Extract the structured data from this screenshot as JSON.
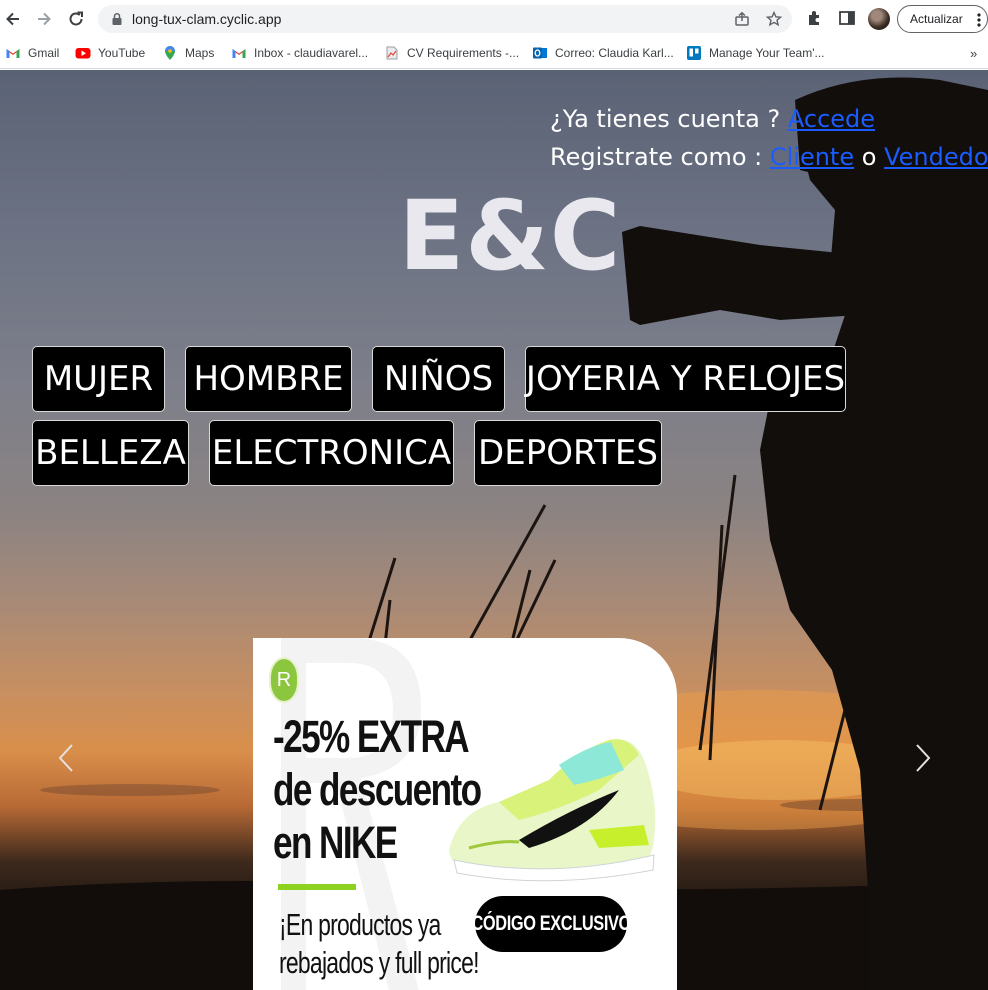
{
  "browser": {
    "url": "long-tux-clam.cyclic.app",
    "update_label": "Actualizar",
    "bookmarks": [
      {
        "label": "Gmail",
        "icon": "gmail-icon"
      },
      {
        "label": "YouTube",
        "icon": "youtube-icon"
      },
      {
        "label": "Maps",
        "icon": "maps-icon"
      },
      {
        "label": "Inbox - claudiavarel...",
        "icon": "gmail-icon"
      },
      {
        "label": "CV Requirements -...",
        "icon": "document-icon"
      },
      {
        "label": "Correo: Claudia Karl...",
        "icon": "outlook-icon"
      },
      {
        "label": "Manage Your Team'...",
        "icon": "trello-icon"
      }
    ],
    "more_bookmarks": "»"
  },
  "header": {
    "account_prompt": "¿Ya tienes cuenta ?",
    "login_link": "Accede",
    "register_prompt": "Registrate como :",
    "client_link": "Cliente",
    "or_text": "o",
    "seller_link": "Vendedor"
  },
  "brand": {
    "name": "E&C"
  },
  "categories": [
    {
      "label": "MUJER"
    },
    {
      "label": "HOMBRE"
    },
    {
      "label": "NIÑOS"
    },
    {
      "label": "JOYERIA Y RELOJES"
    },
    {
      "label": "BELLEZA"
    },
    {
      "label": "ELECTRONICA"
    },
    {
      "label": "DEPORTES"
    }
  ],
  "carousel": {
    "prev_icon": "chevron-left-icon",
    "next_icon": "chevron-right-icon",
    "slide": {
      "badge_letter": "R",
      "headline_line1": "-25% EXTRA",
      "headline_line2": "de descuento",
      "headline_line3": "en NIKE",
      "sub_line1": "¡En productos ya",
      "sub_line2": "rebajados y full price!",
      "button_label": "CÓDIGO EXCLUSIVO"
    }
  },
  "colors": {
    "link": "#1a5cff",
    "category_bg": "#000000",
    "promo_accent": "#8cd21e",
    "badge": "#8cc63f"
  }
}
